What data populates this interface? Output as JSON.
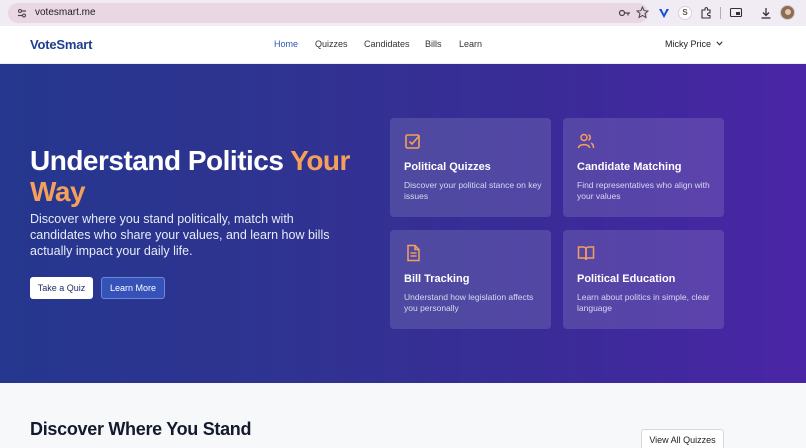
{
  "browser": {
    "url": "votesmart.me",
    "extensions": [
      "tune-icon",
      "password-key-icon",
      "star-icon",
      "vpn-extension-icon",
      "s-extension-icon",
      "puzzle-icon",
      "screen-share-icon",
      "download-icon",
      "profile-avatar"
    ],
    "s_extension_label": "S"
  },
  "nav": {
    "brand": "VoteSmart",
    "links": [
      "Home",
      "Quizzes",
      "Candidates",
      "Bills",
      "Learn"
    ],
    "active_link": "Home",
    "user_name": "Micky Price"
  },
  "hero": {
    "title_part1": "Understand Politics ",
    "title_accent": "Your Way",
    "subtitle": "Discover where you stand politically, match with candidates who share your values, and learn how bills actually impact your daily life.",
    "primary_button": "Take a Quiz",
    "secondary_button": "Learn More",
    "cards": [
      {
        "title": "Political Quizzes",
        "description": "Discover your political stance on key issues",
        "icon": "checkbox-icon"
      },
      {
        "title": "Candidate Matching",
        "description": "Find representatives who align with your values",
        "icon": "users-icon"
      },
      {
        "title": "Bill Tracking",
        "description": "Understand how legislation affects you personally",
        "icon": "document-icon"
      },
      {
        "title": "Political Education",
        "description": "Learn about politics in simple, clear language",
        "icon": "book-icon"
      }
    ]
  },
  "section": {
    "title": "Discover Where You Stand",
    "view_all_button": "View All Quizzes"
  },
  "colors": {
    "brand": "#1e3e8e",
    "accent": "#f5a05a",
    "hero_start": "#25378e",
    "hero_end": "#4a25a6",
    "active_link": "#2a55b8"
  }
}
